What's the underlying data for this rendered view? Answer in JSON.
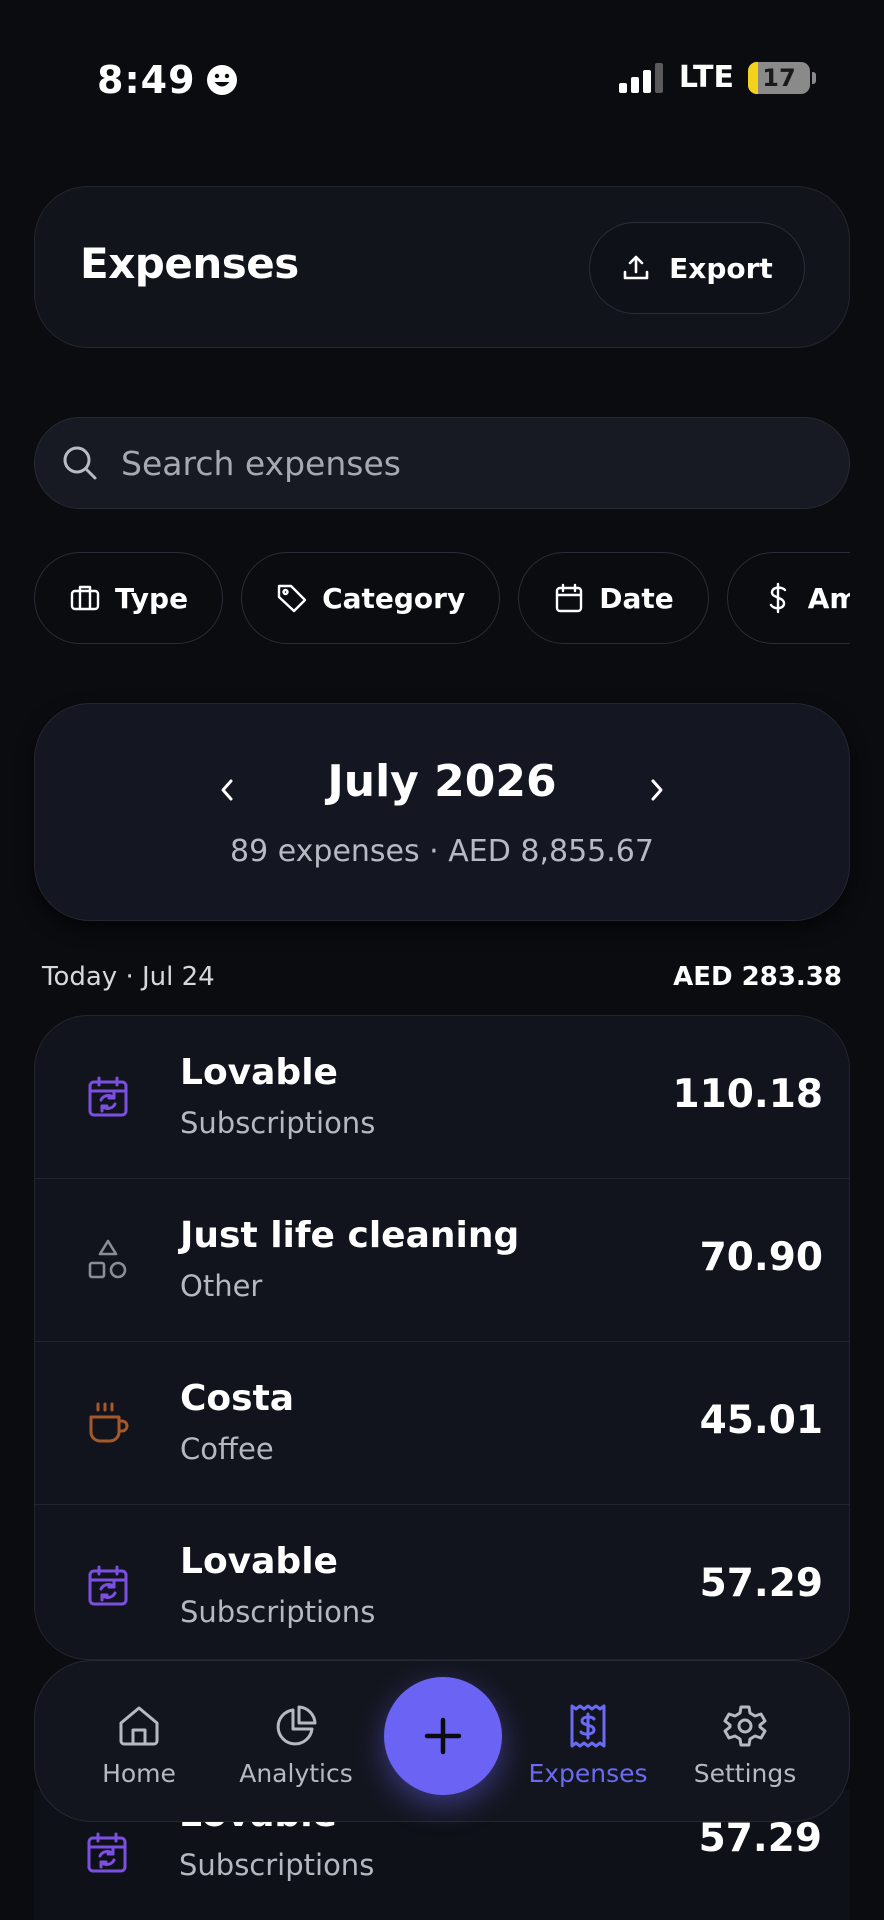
{
  "status_bar": {
    "time": "8:49",
    "network": "LTE",
    "battery": "17"
  },
  "header": {
    "title": "Expenses",
    "export_label": "Export"
  },
  "search": {
    "placeholder": "Search expenses"
  },
  "filters": [
    {
      "label": "Type",
      "icon": "briefcase-icon"
    },
    {
      "label": "Category",
      "icon": "tag-icon"
    },
    {
      "label": "Date",
      "icon": "calendar-icon"
    },
    {
      "label": "Amo",
      "icon": "dollar-icon"
    }
  ],
  "month": {
    "title": "July 2026",
    "summary": "89 expenses · AED 8,855.67"
  },
  "day_group": {
    "label": "Today · Jul 24",
    "total": "AED 283.38"
  },
  "expenses": [
    {
      "name": "Lovable",
      "category": "Subscriptions",
      "amount": "110.18",
      "icon": "calendar-repeat-icon",
      "icon_color": "#7b4fe0"
    },
    {
      "name": "Just life cleaning",
      "category": "Other",
      "amount": "70.90",
      "icon": "shapes-icon",
      "icon_color": "#8a8d96"
    },
    {
      "name": "Costa",
      "category": "Coffee",
      "amount": "45.01",
      "icon": "coffee-icon",
      "icon_color": "#a5582a"
    },
    {
      "name": "Lovable",
      "category": "Subscriptions",
      "amount": "57.29",
      "icon": "calendar-repeat-icon",
      "icon_color": "#7b4fe0"
    }
  ],
  "partial_row": {
    "name": "Lovable",
    "category": "Subscriptions",
    "amount": "57.29"
  },
  "nav": {
    "home": "Home",
    "analytics": "Analytics",
    "expenses": "Expenses",
    "settings": "Settings",
    "active": "Expenses",
    "accent": "#6b6af3"
  }
}
